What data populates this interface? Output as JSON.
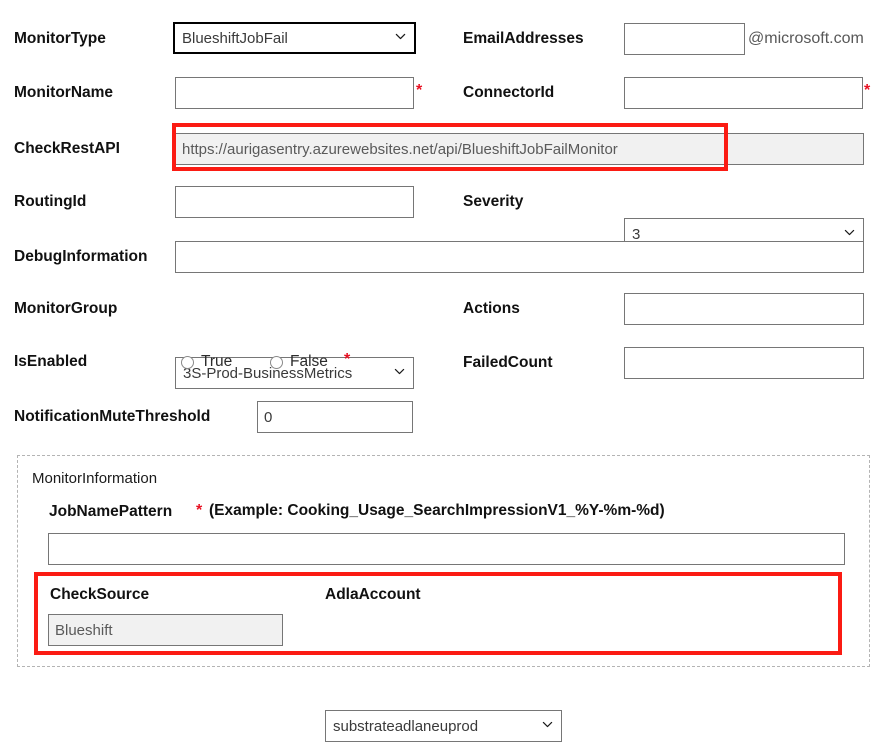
{
  "form": {
    "fields": {
      "monitor_type": {
        "label": "MonitorType",
        "value": "BlueshiftJobFail",
        "control": "select"
      },
      "email_addresses": {
        "label": "EmailAddresses",
        "value": "",
        "placeholder": "",
        "suffix": "@microsoft.com"
      },
      "monitor_name": {
        "label": "MonitorName",
        "value": "",
        "placeholder": "",
        "required_marker": "*"
      },
      "connector_id": {
        "label": "ConnectorId",
        "value": "",
        "placeholder": "",
        "required_marker": "*"
      },
      "check_rest_api": {
        "label": "CheckRestAPI",
        "value": "https://aurigasentry.azurewebsites.net/api/BlueshiftJobFailMonitor",
        "readonly": true
      },
      "routing_id": {
        "label": "RoutingId",
        "value": "",
        "placeholder": ""
      },
      "severity": {
        "label": "Severity",
        "value": "3",
        "control": "select"
      },
      "debug_information": {
        "label": "DebugInformation",
        "value": "",
        "placeholder": ""
      },
      "monitor_group": {
        "label": "MonitorGroup",
        "value": "3S-Prod-BusinessMetrics",
        "control": "select"
      },
      "actions": {
        "label": "Actions",
        "value": "",
        "placeholder": ""
      },
      "is_enabled": {
        "label": "IsEnabled",
        "options": [
          {
            "label": "True",
            "selected": false
          },
          {
            "label": "False",
            "selected": false
          }
        ],
        "required_marker": "*"
      },
      "failed_count": {
        "label": "FailedCount",
        "value": "",
        "placeholder": ""
      },
      "notification_mute_threshold": {
        "label": "NotificationMuteThreshold",
        "value": "0"
      }
    },
    "monitor_information": {
      "legend": "MonitorInformation",
      "job_name_pattern": {
        "label": "JobNamePattern",
        "required_marker": "*",
        "example": "(Example: Cooking_Usage_SearchImpressionV1_%Y-%m-%d)",
        "value": "",
        "placeholder": ""
      },
      "check_source": {
        "label": "CheckSource",
        "value": "Blueshift",
        "readonly": true
      },
      "adla_account": {
        "label": "AdlaAccount",
        "value": "substrateadlaneuprod",
        "control": "select"
      }
    }
  },
  "annotations": {
    "highlight_color": "#fb1b13",
    "boxes": [
      {
        "name": "check-rest-api-highlight"
      },
      {
        "name": "check-source-adla-highlight"
      }
    ]
  }
}
